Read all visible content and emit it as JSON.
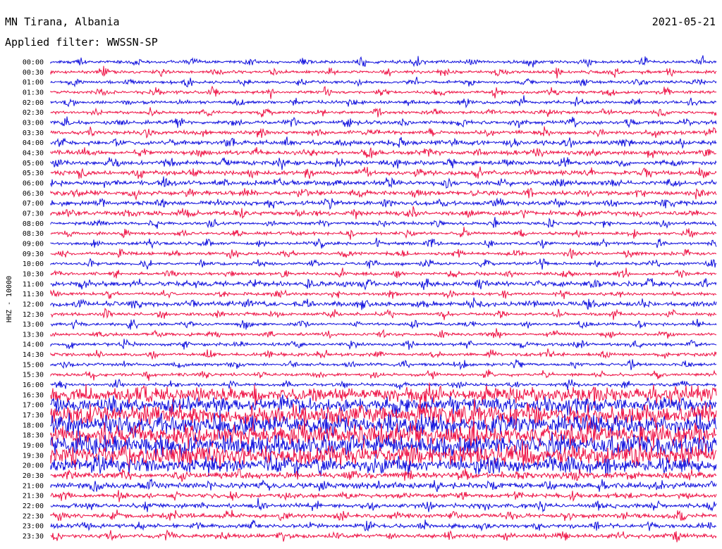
{
  "header": {
    "station": "MN Tirana, Albania",
    "date": "2021-05-21",
    "filter": "Applied filter: WWSSN-SP"
  },
  "axis": {
    "channel_label": "HHZ - 10000"
  },
  "colors": {
    "trace_a": "#1010dd",
    "trace_b": "#ee1144",
    "text": "#000000"
  },
  "traces": [
    {
      "time": "00:00",
      "color": "trace_a"
    },
    {
      "time": "00:30",
      "color": "trace_b"
    },
    {
      "time": "01:00",
      "color": "trace_a"
    },
    {
      "time": "01:30",
      "color": "trace_b"
    },
    {
      "time": "02:00",
      "color": "trace_a"
    },
    {
      "time": "02:30",
      "color": "trace_b"
    },
    {
      "time": "03:00",
      "color": "trace_a"
    },
    {
      "time": "03:30",
      "color": "trace_b"
    },
    {
      "time": "04:00",
      "color": "trace_a"
    },
    {
      "time": "04:30",
      "color": "trace_b"
    },
    {
      "time": "05:00",
      "color": "trace_a"
    },
    {
      "time": "05:30",
      "color": "trace_b"
    },
    {
      "time": "06:00",
      "color": "trace_a"
    },
    {
      "time": "06:30",
      "color": "trace_b"
    },
    {
      "time": "07:00",
      "color": "trace_a"
    },
    {
      "time": "07:30",
      "color": "trace_b"
    },
    {
      "time": "08:00",
      "color": "trace_a"
    },
    {
      "time": "08:30",
      "color": "trace_b"
    },
    {
      "time": "09:00",
      "color": "trace_a"
    },
    {
      "time": "09:30",
      "color": "trace_b"
    },
    {
      "time": "10:00",
      "color": "trace_a"
    },
    {
      "time": "10:30",
      "color": "trace_b"
    },
    {
      "time": "11:00",
      "color": "trace_a"
    },
    {
      "time": "11:30",
      "color": "trace_b"
    },
    {
      "time": "12:00",
      "color": "trace_a"
    },
    {
      "time": "12:30",
      "color": "trace_b"
    },
    {
      "time": "13:00",
      "color": "trace_a"
    },
    {
      "time": "13:30",
      "color": "trace_b"
    },
    {
      "time": "14:00",
      "color": "trace_a"
    },
    {
      "time": "14:30",
      "color": "trace_b"
    },
    {
      "time": "15:00",
      "color": "trace_a"
    },
    {
      "time": "15:30",
      "color": "trace_b"
    },
    {
      "time": "16:00",
      "color": "trace_a"
    },
    {
      "time": "16:30",
      "color": "trace_b"
    },
    {
      "time": "17:00",
      "color": "trace_a"
    },
    {
      "time": "17:30",
      "color": "trace_b"
    },
    {
      "time": "18:00",
      "color": "trace_a"
    },
    {
      "time": "18:30",
      "color": "trace_b"
    },
    {
      "time": "19:00",
      "color": "trace_a"
    },
    {
      "time": "19:30",
      "color": "trace_b"
    },
    {
      "time": "20:00",
      "color": "trace_a"
    },
    {
      "time": "20:30",
      "color": "trace_b"
    },
    {
      "time": "21:00",
      "color": "trace_a"
    },
    {
      "time": "21:30",
      "color": "trace_b"
    },
    {
      "time": "22:00",
      "color": "trace_a"
    },
    {
      "time": "22:30",
      "color": "trace_b"
    },
    {
      "time": "23:00",
      "color": "trace_a"
    },
    {
      "time": "23:30",
      "color": "trace_b"
    }
  ]
}
